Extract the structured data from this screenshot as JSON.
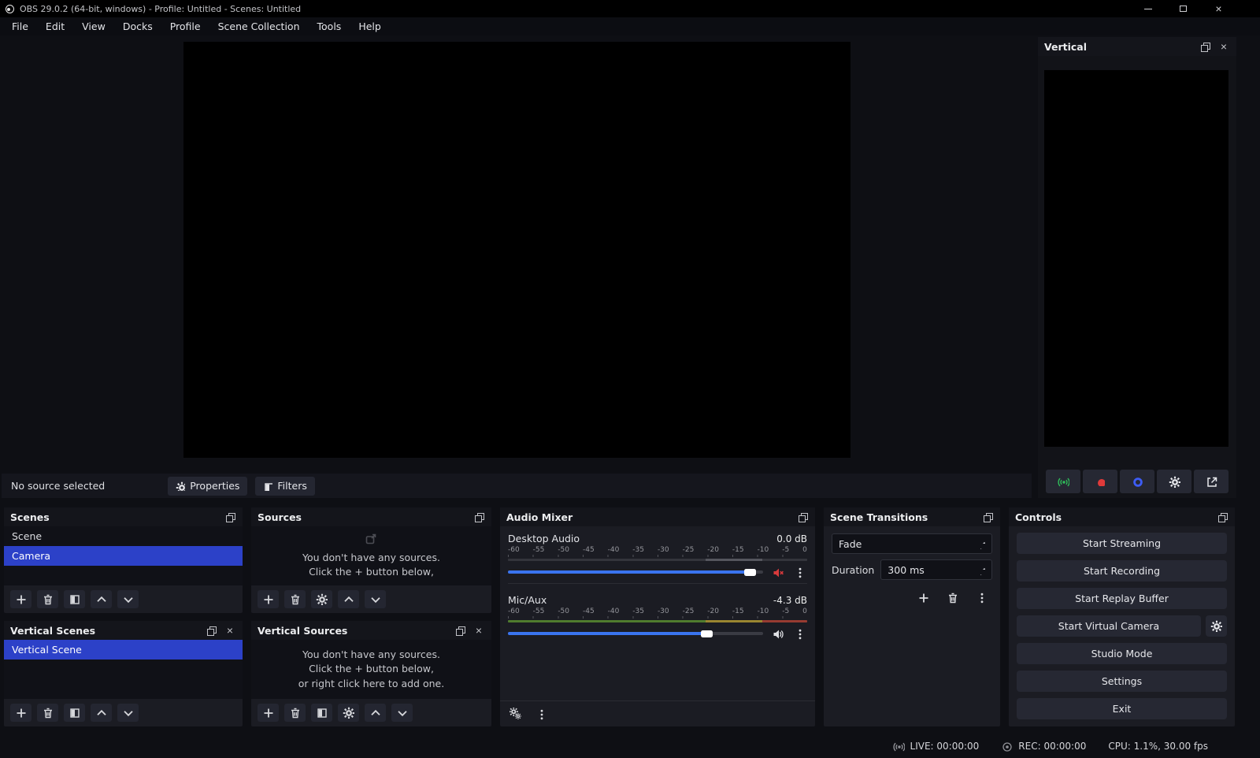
{
  "colors": {
    "accent": "#3a74ef",
    "selection": "#2c41c8",
    "mute_red": "#d83a3c",
    "record_red": "#e03a3a",
    "stream_green": "#2fbe5a",
    "virtual_blue": "#3d5cf5",
    "meter_green": "#507c2e",
    "meter_yellow": "#9a8530",
    "meter_red": "#973b31"
  },
  "icons": {
    "close_glyph": "×"
  },
  "window": {
    "title": "OBS 29.0.2 (64-bit, windows) - Profile: Untitled - Scenes: Untitled"
  },
  "menu": {
    "items": [
      "File",
      "Edit",
      "View",
      "Docks",
      "Profile",
      "Scene Collection",
      "Tools",
      "Help"
    ]
  },
  "source_toolbar": {
    "status": "No source selected",
    "properties": "Properties",
    "filters": "Filters"
  },
  "vertical_dock": {
    "title": "Vertical"
  },
  "scenes": {
    "title": "Scenes",
    "items": [
      {
        "label": "Scene"
      },
      {
        "label": "Camera"
      }
    ]
  },
  "vertical_scenes": {
    "title": "Vertical Scenes",
    "items": [
      {
        "label": "Vertical Scene"
      }
    ]
  },
  "sources": {
    "title": "Sources",
    "empty": [
      "You don't have any sources.",
      "Click the + button below,"
    ]
  },
  "vertical_sources": {
    "title": "Vertical Sources",
    "empty": [
      "You don't have any sources.",
      "Click the + button below,",
      "or right click here to add one."
    ]
  },
  "audio_mixer": {
    "title": "Audio Mixer",
    "ticks": [
      "-60",
      "-55",
      "-50",
      "-45",
      "-40",
      "-35",
      "-30",
      "-25",
      "-20",
      "-15",
      "-10",
      "-5",
      "0"
    ],
    "channels": [
      {
        "name": "Desktop Audio",
        "db": "0.0 dB",
        "muted": true,
        "slider_pct": 95
      },
      {
        "name": "Mic/Aux",
        "db": "-4.3 dB",
        "muted": false,
        "slider_pct": 78
      }
    ]
  },
  "scene_transitions": {
    "title": "Scene Transitions",
    "transition": "Fade",
    "duration_label": "Duration",
    "duration_value": "300 ms"
  },
  "controls": {
    "title": "Controls",
    "buttons": [
      "Start Streaming",
      "Start Recording",
      "Start Replay Buffer",
      "Start Virtual Camera",
      "Studio Mode",
      "Settings",
      "Exit"
    ]
  },
  "statusbar": {
    "live": "LIVE: 00:00:00",
    "rec": "REC: 00:00:00",
    "cpu": "CPU: 1.1%, 30.00 fps"
  }
}
